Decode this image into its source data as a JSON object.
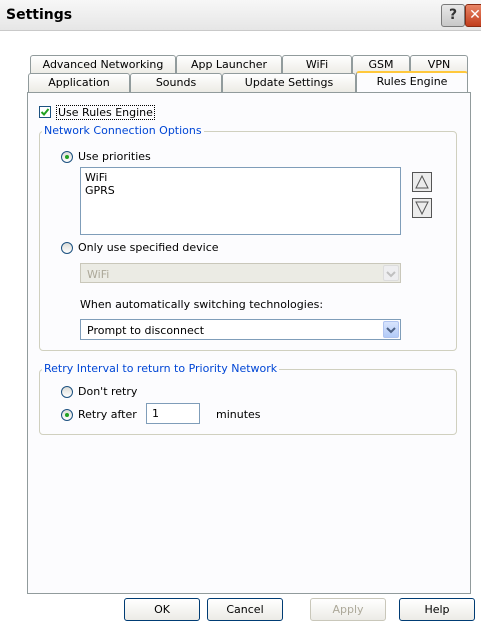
{
  "window": {
    "title": "Settings"
  },
  "tabs_back": [
    "Advanced Networking",
    "App Launcher",
    "WiFi",
    "GSM",
    "VPN"
  ],
  "tabs_front": [
    "Application",
    "Sounds",
    "Update Settings",
    "Rules Engine"
  ],
  "active_tab": "Rules Engine",
  "use_rules_engine": {
    "label": "Use Rules Engine",
    "checked": true
  },
  "network_group": {
    "legend": "Network Connection Options",
    "use_priorities": {
      "label": "Use priorities",
      "selected": true
    },
    "priority_list": [
      "WiFi",
      "GPRS"
    ],
    "only_specified": {
      "label": "Only use specified device",
      "selected": false
    },
    "device_combo": {
      "value": "WiFi",
      "disabled": true
    },
    "switch_label": "When automatically switching technologies:",
    "switch_combo": {
      "value": "Prompt to disconnect"
    }
  },
  "retry_group": {
    "legend": "Retry Interval to return to Priority Network",
    "dont_retry": {
      "label": "Don't retry",
      "selected": false
    },
    "retry_after": {
      "label": "Retry after",
      "selected": true
    },
    "minutes_value": "1",
    "minutes_label": "minutes"
  },
  "buttons": {
    "ok": "OK",
    "cancel": "Cancel",
    "apply": "Apply",
    "help": "Help"
  }
}
